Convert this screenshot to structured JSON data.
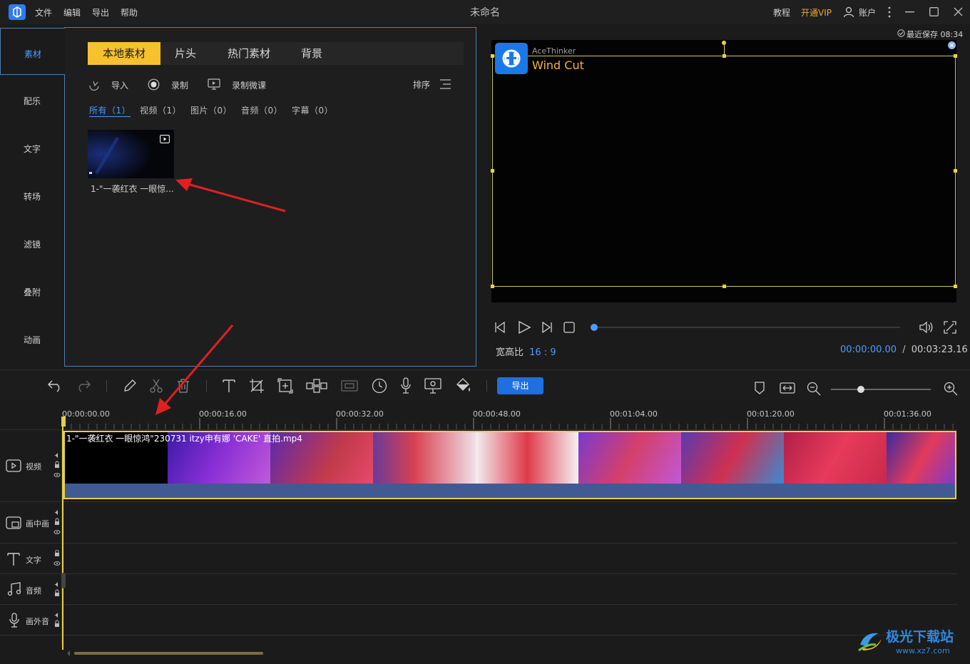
{
  "titlebar": {
    "title": "未命名",
    "menu": [
      "文件",
      "编辑",
      "导出",
      "帮助"
    ],
    "tutorial": "教程",
    "vip": "开通VIP",
    "account": "账户"
  },
  "leftnav": {
    "items": [
      "素材",
      "配乐",
      "文字",
      "转场",
      "滤镜",
      "叠附",
      "动画"
    ]
  },
  "media": {
    "tabs": [
      "本地素材",
      "片头",
      "热门素材",
      "背景"
    ],
    "tools": {
      "import": "导入",
      "record": "录制",
      "record_lesson": "录制微课",
      "sort": "排序"
    },
    "filters": [
      "所有（1）",
      "视频（1）",
      "图片（0）",
      "音频（0）",
      "字幕（0）"
    ],
    "item_name": "1-\"一袭红衣 一眼惊..."
  },
  "preview": {
    "saved": "最近保存 08:34",
    "brand_top": "AceThinker",
    "brand_name": "Wind Cut",
    "aspect_label": "宽高比",
    "aspect_value": "16 : 9",
    "current_time": "00:00:00.00",
    "separator": "/",
    "total_time": "00:03:23.16",
    "progress": 0
  },
  "toolbar": {
    "export": "导出",
    "zoom_level": 0.3
  },
  "timeline": {
    "ticks": [
      "00:00:00.00",
      "00:00:16.00",
      "00:00:32.00",
      "00:00:48.00",
      "00:01:04.00",
      "00:01:20.00",
      "00:01:36.00"
    ],
    "tracks": [
      "视频",
      "画中画",
      "文字",
      "音频",
      "画外音"
    ],
    "clip_name": "1-\"一袭红衣 一眼惊鸿\"230731 itzy申有娜 'CAKE' 直拍.mp4"
  },
  "watermark": {
    "text": "极光下载站",
    "url": "www.xz7.com"
  },
  "colors": {
    "accent": "#4a9dff",
    "tab_active": "#f6c12e",
    "vip": "#f0a531",
    "export_btn": "#1f6fe0",
    "clip_border": "#e6cf4a"
  }
}
